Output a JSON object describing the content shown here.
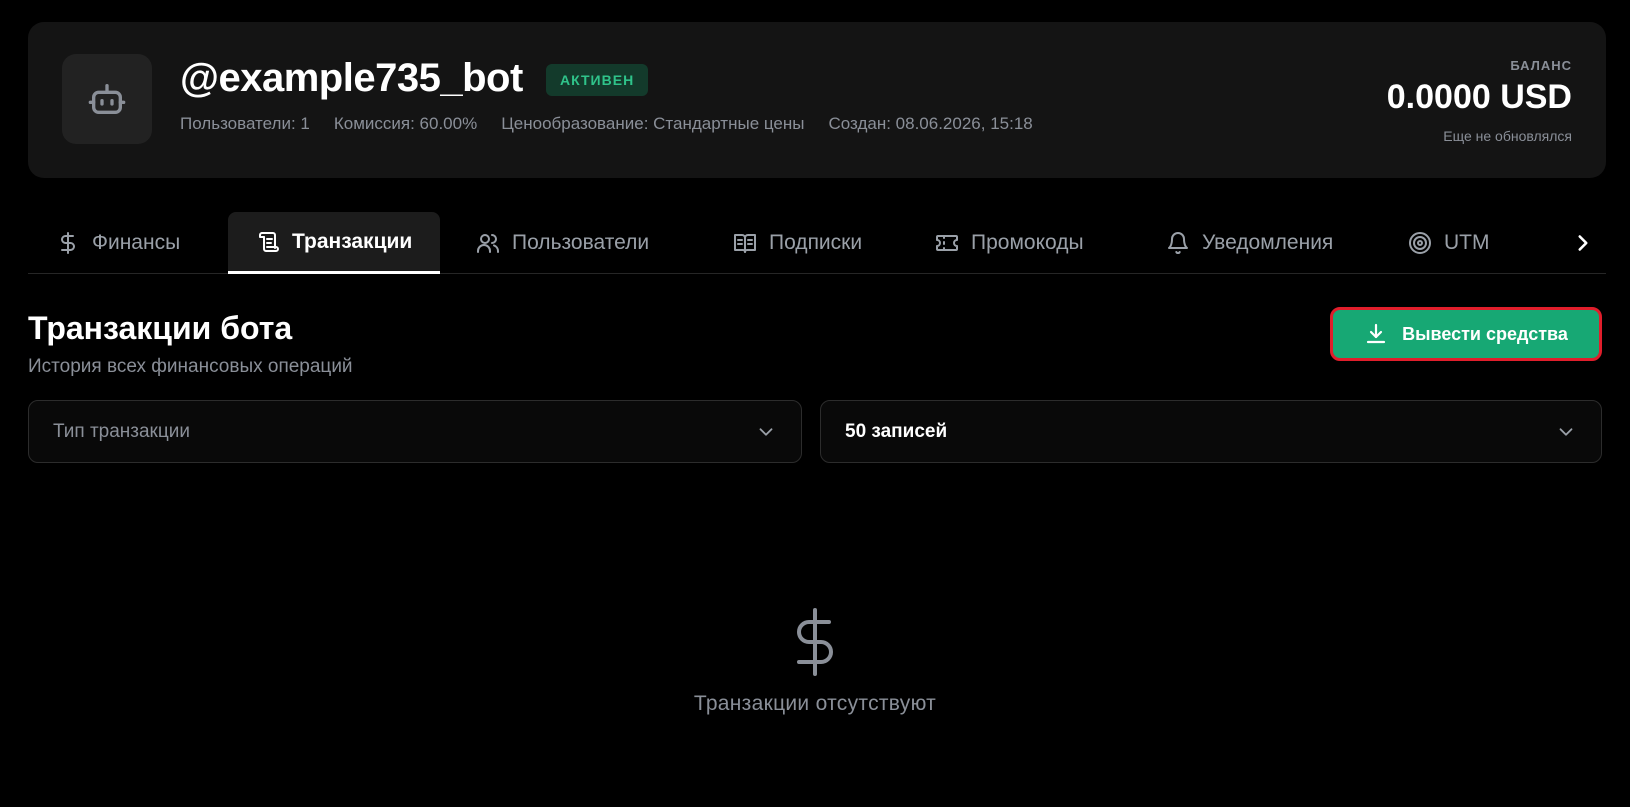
{
  "header": {
    "bot_name": "@example735_bot",
    "status": "АКТИВЕН",
    "meta": {
      "users": "Пользователи: 1",
      "commission": "Комиссия: 60.00%",
      "pricing": "Ценообразование: Стандартные цены",
      "created": "Создан: 08.06.2026, 15:18"
    },
    "balance": {
      "label": "БАЛАНС",
      "value": "0.0000 USD",
      "updated": "Еще не обновлялся"
    }
  },
  "tabs": [
    {
      "label": "Финансы",
      "icon": "dollar-icon"
    },
    {
      "label": "Транзакции",
      "icon": "receipt-icon",
      "active": true
    },
    {
      "label": "Пользователи",
      "icon": "users-icon"
    },
    {
      "label": "Подписки",
      "icon": "book-icon"
    },
    {
      "label": "Промокоды",
      "icon": "ticket-icon"
    },
    {
      "label": "Уведомления",
      "icon": "bell-icon"
    },
    {
      "label": "UTM",
      "icon": "target-icon"
    }
  ],
  "section": {
    "title": "Транзакции бота",
    "subtitle": "История всех финансовых операций",
    "withdraw_label": "Вывести средства"
  },
  "filters": {
    "type_placeholder": "Тип транзакции",
    "limit_value": "50 записей"
  },
  "empty_state": {
    "text": "Транзакции отсутствуют"
  },
  "colors": {
    "accent": "#17a874",
    "status_text": "#2fc38a",
    "highlight_border": "#e01e2b"
  }
}
